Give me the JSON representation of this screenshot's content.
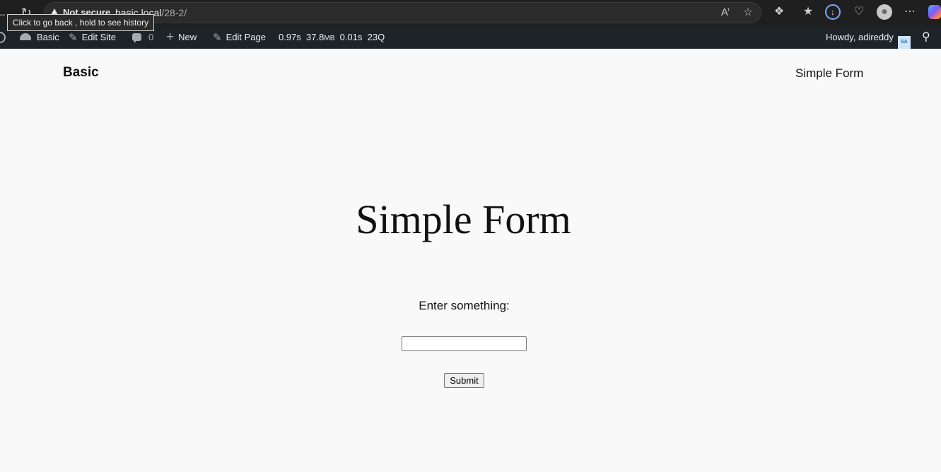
{
  "browser": {
    "tooltip": "Click to go back , hold to see history",
    "security_label": "Not secure",
    "url_host": "basic.local",
    "url_path": "/28-2/",
    "icons": [
      "back-icon",
      "refresh-icon",
      "read-aloud-icon",
      "favorite-star-icon",
      "extensions-icon",
      "favorites-icon",
      "downloads-icon",
      "browser-essentials-icon",
      "profile-icon",
      "more-icon",
      "copilot-icon"
    ]
  },
  "admin_bar": {
    "site_name": "Basic",
    "edit_site": "Edit Site",
    "comments_count": "0",
    "new_label": "New",
    "edit_page": "Edit Page",
    "qm_time": "0.97s",
    "qm_memory": "37.8",
    "qm_memory_unit": "MB",
    "qm_db_time": "0.01s",
    "qm_queries": "23Q",
    "howdy": "Howdy, adireddy",
    "avatar_initials": "SA"
  },
  "site": {
    "title": "Basic",
    "nav_link": "Simple Form"
  },
  "page": {
    "title": "Simple Form",
    "form_label": "Enter something:",
    "input_value": "",
    "submit_label": "Submit"
  }
}
